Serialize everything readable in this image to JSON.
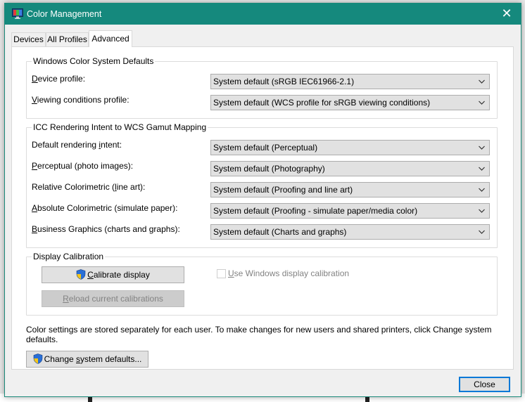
{
  "window": {
    "title": "Color Management",
    "close_glyph": "✕",
    "accent_color": "#15897d"
  },
  "tabs": [
    {
      "label": "Devices",
      "selected": false
    },
    {
      "label": "All Profiles",
      "selected": false
    },
    {
      "label": "Advanced",
      "selected": true
    }
  ],
  "wcs_defaults": {
    "heading": "Windows Color System Defaults",
    "device_profile": {
      "label_pre": "",
      "label_key": "D",
      "label_post": "evice profile:",
      "value": "System default (sRGB IEC61966-2.1)"
    },
    "viewing_conditions": {
      "label_pre": "",
      "label_key": "V",
      "label_post": "iewing conditions profile:",
      "value": "System default (WCS profile for sRGB viewing conditions)"
    }
  },
  "icc_mapping": {
    "heading": "ICC Rendering Intent to WCS Gamut Mapping",
    "rows": [
      {
        "label_pre": "Default rendering ",
        "label_key": "i",
        "label_post": "ntent:",
        "value": "System default (Perceptual)"
      },
      {
        "label_pre": "",
        "label_key": "P",
        "label_post": "erceptual (photo images):",
        "value": "System default (Photography)"
      },
      {
        "label_pre": "Relative Colorimetric (",
        "label_key": "l",
        "label_post": "ine art):",
        "value": "System default (Proofing and line art)"
      },
      {
        "label_pre": "",
        "label_key": "A",
        "label_post": "bsolute Colorimetric (simulate paper):",
        "value": "System default (Proofing - simulate paper/media color)"
      },
      {
        "label_pre": "",
        "label_key": "B",
        "label_post": "usiness Graphics (charts and graphs):",
        "value": "System default (Charts and graphs)"
      }
    ]
  },
  "display_calibration": {
    "heading": "Display Calibration",
    "calibrate_button": {
      "pre": "",
      "key": "C",
      "post": "alibrate display",
      "icon": "uac-shield-icon"
    },
    "reload_button": {
      "pre": "",
      "key": "R",
      "post": "eload current calibrations",
      "disabled": true
    },
    "use_windows_calibration": {
      "pre": "",
      "key": "U",
      "post": "se Windows display calibration",
      "checked": false,
      "disabled": true
    }
  },
  "footer": {
    "info_text": "Color settings are stored separately for each user. To make changes for new users and shared printers, click Change system defaults.",
    "change_defaults_button": {
      "pre": "Change ",
      "key": "s",
      "post": "ystem defaults...",
      "icon": "uac-shield-icon"
    },
    "close_button": "Close"
  }
}
